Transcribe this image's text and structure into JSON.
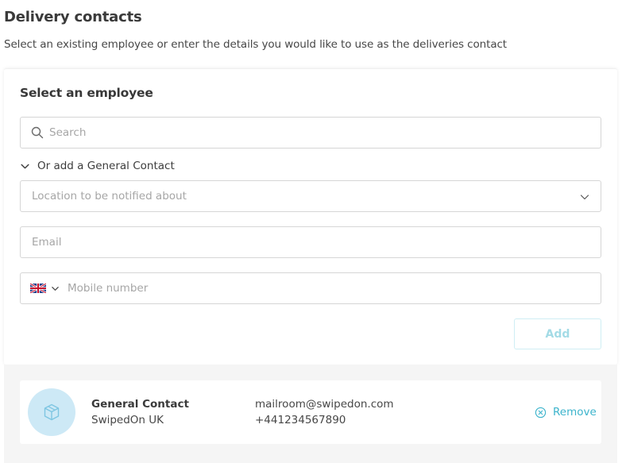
{
  "header": {
    "title": "Delivery contacts",
    "subtitle": "Select an existing employee or enter the details you would like to use as the deliveries contact"
  },
  "form": {
    "title": "Select an employee",
    "search": {
      "placeholder": "Search",
      "icon": "search-icon"
    },
    "general_contact_toggle": "Or add a General Contact",
    "location_select": {
      "placeholder": "Location to be notified about",
      "icon": "chevron-down-icon"
    },
    "email": {
      "placeholder": "Email"
    },
    "phone": {
      "placeholder": "Mobile number",
      "country_flag": "uk-flag-icon"
    },
    "add_label": "Add"
  },
  "contacts": [
    {
      "name": "General Contact",
      "organization": "SwipedOn UK",
      "email": "mailroom@swipedon.com",
      "phone": "+441234567890",
      "avatar_icon": "package-icon",
      "remove_label": "Remove"
    }
  ],
  "colors": {
    "accent": "#3cb4cc",
    "accent_disabled": "#a3dbe6",
    "avatar_bg": "#cde9f6",
    "list_bg": "#f5f5f5"
  }
}
